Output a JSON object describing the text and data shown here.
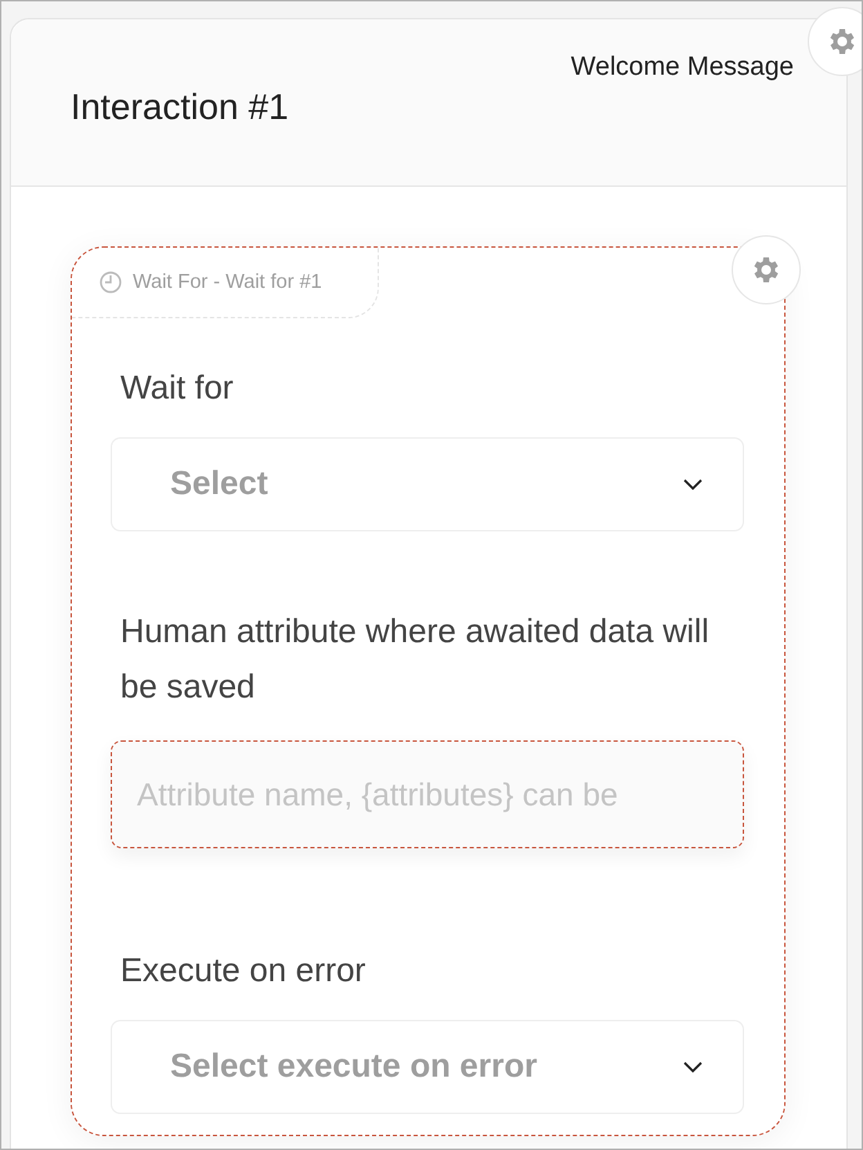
{
  "card": {
    "title": "Interaction #1",
    "subtitle": "Welcome Message"
  },
  "block": {
    "tag": "Wait For - Wait for #1",
    "invalid": true,
    "fields": [
      {
        "kind": "select",
        "label": "Wait for",
        "value": "Select",
        "invalid": false
      },
      {
        "kind": "text",
        "label": "Human attribute where awaited data will be saved",
        "placeholder": "Attribute name, {attributes} can be",
        "invalid": true
      },
      {
        "kind": "select",
        "label": "Execute on error",
        "value": "Select execute on error",
        "invalid": false
      }
    ]
  }
}
